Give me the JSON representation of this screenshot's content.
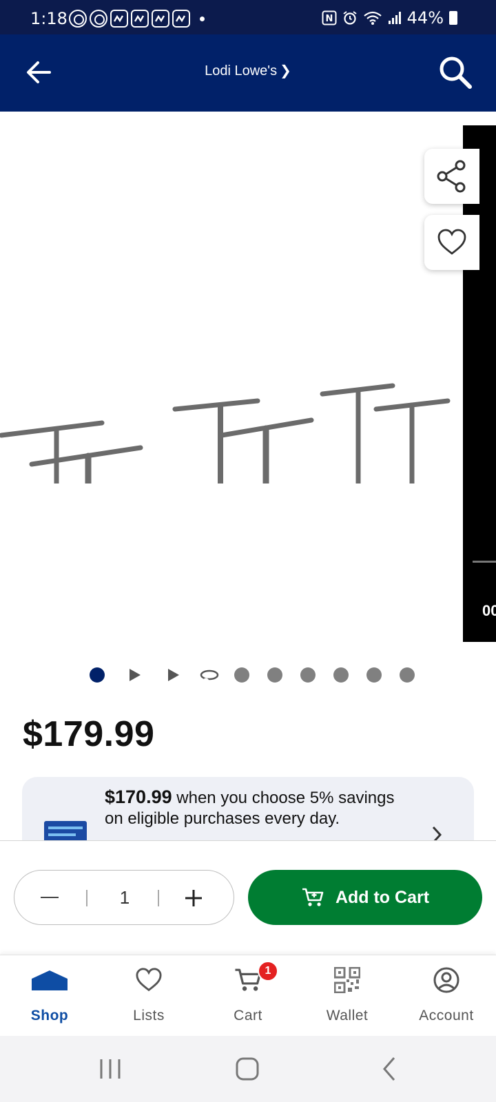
{
  "status_bar": {
    "time": "1:18",
    "battery": "44%"
  },
  "header": {
    "store_name": "Lodi Lowe's",
    "store_chevron": "❯"
  },
  "gallery": {
    "side_panel_text": "00",
    "image_icon": "overhead-storage-rack-image"
  },
  "carousel": {
    "active_index": 0,
    "item_types": [
      "image",
      "video",
      "video",
      "360",
      "image",
      "image",
      "image",
      "image",
      "image",
      "image"
    ]
  },
  "product": {
    "price": "$179.99"
  },
  "promo": {
    "price": "$170.99",
    "text_line1": "when you choose 5% savings",
    "text_line2": "on eligible purchases every day."
  },
  "cart_bar": {
    "quantity": "1",
    "add_to_cart_label": "Add to Cart"
  },
  "bottom_nav": {
    "items": [
      {
        "label": "Shop",
        "icon": "store-icon",
        "active": true
      },
      {
        "label": "Lists",
        "icon": "heart-icon",
        "active": false
      },
      {
        "label": "Cart",
        "icon": "cart-icon",
        "active": false
      },
      {
        "label": "Wallet",
        "icon": "qr-code-icon",
        "active": false
      },
      {
        "label": "Account",
        "icon": "account-icon",
        "active": false
      }
    ],
    "cart_badge": "1"
  },
  "colors": {
    "header_bg": "#012169",
    "status_bg": "#0c1b4d",
    "add_to_cart": "#007d32",
    "active_nav": "#0e4da4",
    "badge": "#e42121"
  }
}
